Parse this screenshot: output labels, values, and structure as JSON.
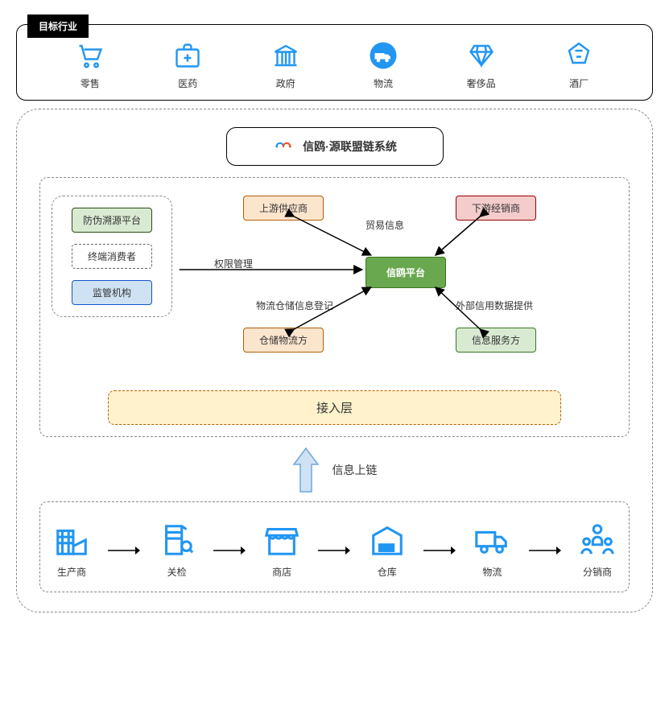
{
  "header": {
    "tag": "目标行业"
  },
  "industries": [
    {
      "label": "零售",
      "icon": "cart"
    },
    {
      "label": "医药",
      "icon": "medkit"
    },
    {
      "label": "政府",
      "icon": "government"
    },
    {
      "label": "物流",
      "icon": "truck-circle"
    },
    {
      "label": "奢侈品",
      "icon": "diamond"
    },
    {
      "label": "酒厂",
      "icon": "wine"
    }
  ],
  "title": "信鸥·源联盟链系统",
  "leftPanel": {
    "items": [
      {
        "label": "防伪溯源平台",
        "style": "green"
      },
      {
        "label": "终端消费者",
        "style": "dashed"
      },
      {
        "label": "监管机构",
        "style": "blue"
      }
    ]
  },
  "core": {
    "center": "信鸥平台",
    "upstream": "上游供应商",
    "downstream": "下游经销商",
    "storage": "仓储物流方",
    "service": "信息服务方",
    "edges": {
      "permission": "权限管理",
      "trade": "贸易信息",
      "logistics": "物流仓储信息登记",
      "external": "外部信用数据提供"
    }
  },
  "accessLayer": "接入层",
  "upload": "信息上链",
  "chain": [
    {
      "label": "生产商",
      "icon": "factory"
    },
    {
      "label": "关检",
      "icon": "customs"
    },
    {
      "label": "商店",
      "icon": "store"
    },
    {
      "label": "仓库",
      "icon": "warehouse"
    },
    {
      "label": "物流",
      "icon": "truck"
    },
    {
      "label": "分销商",
      "icon": "people"
    }
  ],
  "colors": {
    "blue": "#2196f3",
    "green": "#6aa84f"
  }
}
